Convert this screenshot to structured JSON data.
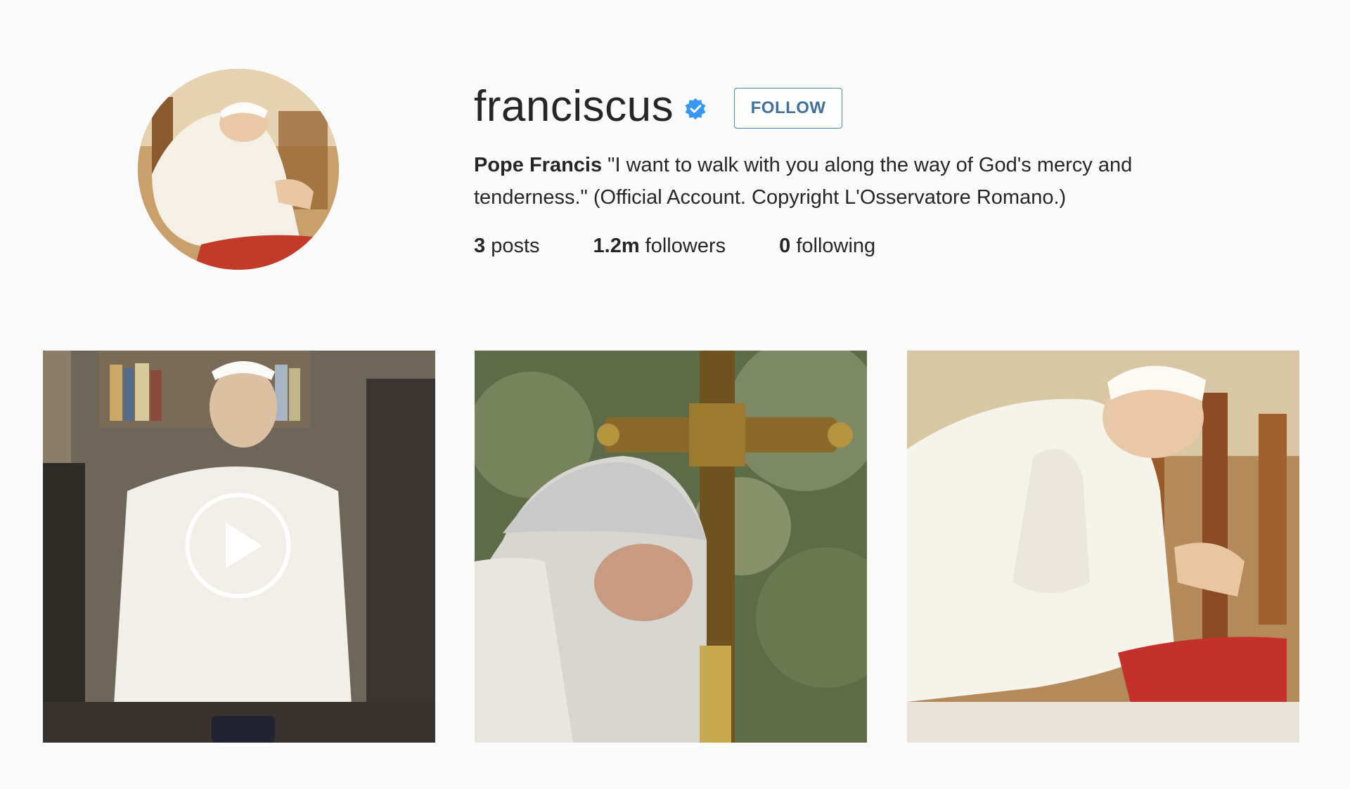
{
  "profile": {
    "username": "franciscus",
    "verified_icon": "verified-badge-icon",
    "follow_label": "FOLLOW",
    "bio_name": "Pope Francis",
    "bio_text": " \"I want to walk with you along the way of God's mercy and tenderness.\" (Official Account. Copyright L'Osservatore Romano.)",
    "stats": {
      "posts_count": "3",
      "posts_label": " posts",
      "followers_count": "1.2m",
      "followers_label": " followers",
      "following_count": "0",
      "following_label": " following"
    }
  },
  "posts": [
    {
      "kind": "video",
      "icon": "play-icon"
    },
    {
      "kind": "photo"
    },
    {
      "kind": "photo"
    }
  ],
  "colors": {
    "background": "#fafafa",
    "follow_accent": "#3f729b",
    "verified_blue": "#3897f0"
  }
}
